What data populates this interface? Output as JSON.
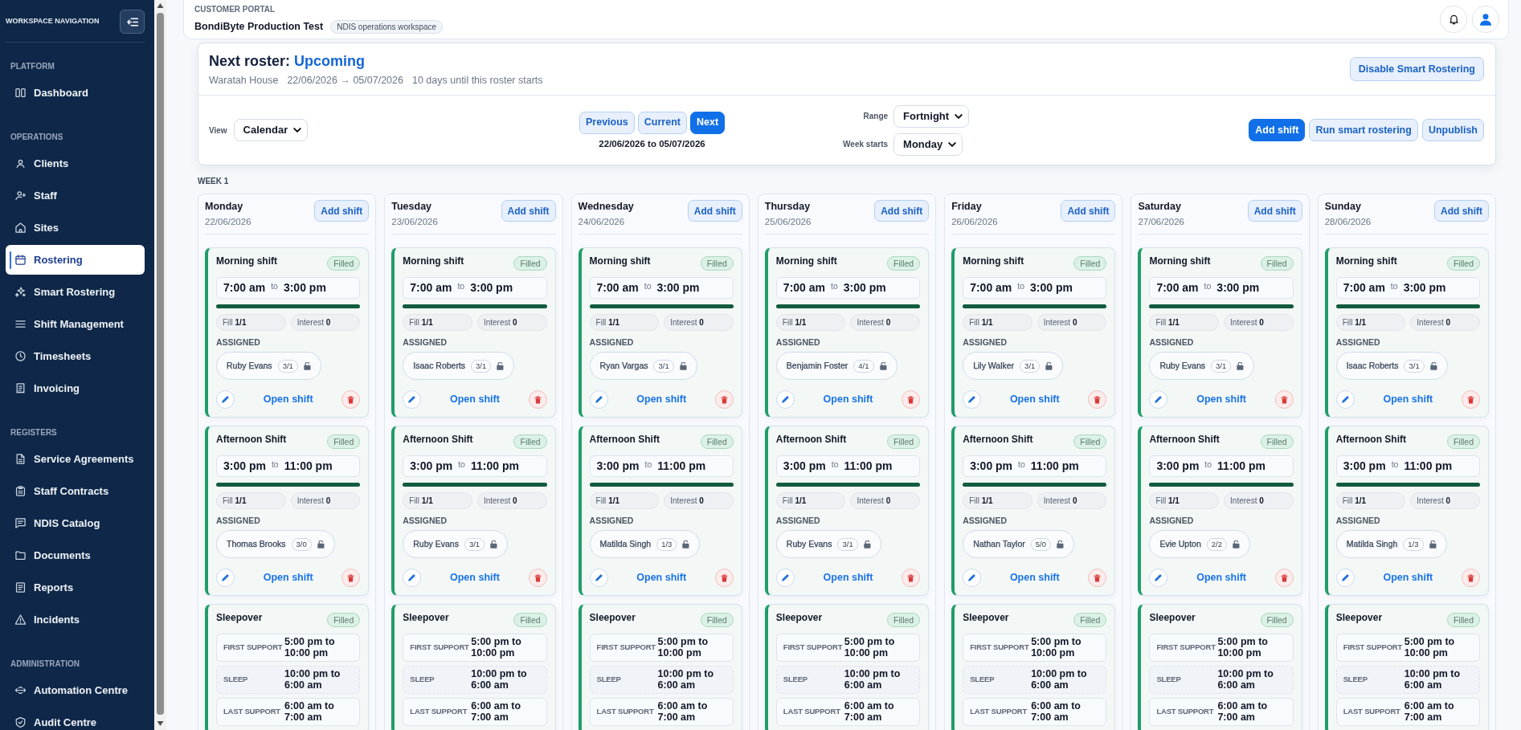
{
  "sidebar": {
    "title": "WORKSPACE NAVIGATION",
    "sections": [
      {
        "heading": "PLATFORM",
        "items": [
          {
            "label": "Dashboard",
            "selected": false
          }
        ]
      },
      {
        "heading": "OPERATIONS",
        "items": [
          {
            "label": "Clients",
            "selected": false
          },
          {
            "label": "Staff",
            "selected": false
          },
          {
            "label": "Sites",
            "selected": false
          },
          {
            "label": "Rostering",
            "selected": true
          },
          {
            "label": "Smart Rostering",
            "selected": false
          },
          {
            "label": "Shift Management",
            "selected": false
          },
          {
            "label": "Timesheets",
            "selected": false
          },
          {
            "label": "Invoicing",
            "selected": false
          }
        ]
      },
      {
        "heading": "REGISTERS",
        "items": [
          {
            "label": "Service Agreements",
            "selected": false
          },
          {
            "label": "Staff Contracts",
            "selected": false
          },
          {
            "label": "NDIS Catalog",
            "selected": false
          },
          {
            "label": "Documents",
            "selected": false
          },
          {
            "label": "Reports",
            "selected": false
          },
          {
            "label": "Incidents",
            "selected": false
          }
        ]
      },
      {
        "heading": "ADMINISTRATION",
        "items": [
          {
            "label": "Automation Centre",
            "selected": false
          },
          {
            "label": "Audit Centre",
            "selected": false
          }
        ]
      }
    ]
  },
  "header": {
    "eyebrow": "CUSTOMER PORTAL",
    "title": "BondiByte Production Test",
    "badge": "NDIS operations workspace"
  },
  "roster": {
    "title": "Next roster:",
    "status": "Upcoming",
    "details": [
      "Waratah House",
      "22/06/2026 → 05/07/2026",
      "10 days until this roster starts"
    ],
    "action": "Disable Smart Rostering"
  },
  "toolbar": {
    "view": {
      "label": "View",
      "value": "Calendar"
    },
    "nav": [
      {
        "label": "Previous",
        "selected": false
      },
      {
        "label": "Current",
        "selected": false
      },
      {
        "label": "Next",
        "selected": true
      }
    ],
    "period": "22/06/2026 to 05/07/2026",
    "range": {
      "label": "Range",
      "value": "Fortnight"
    },
    "week_start": {
      "label": "Week starts",
      "value": "Monday"
    },
    "actions": [
      {
        "label": "Add shift",
        "primary": true
      },
      {
        "label": "Run smart rostering",
        "primary": false
      },
      {
        "label": "Unpublish",
        "primary": false
      }
    ]
  },
  "week": {
    "label": "WEEK 1",
    "days": [
      {
        "name": "Monday",
        "date": "22/06/2026",
        "add_label": "Add shift",
        "shifts": [
          {
            "kind": "standard",
            "title": "Morning shift",
            "status": "Filled",
            "start": "7:00 am",
            "to": "to",
            "end": "3:00 pm",
            "level": 1,
            "fill": "Fill **1/1**",
            "interest": "Interest **0**",
            "assigned_label": "ASSIGNED",
            "assignees": [
              {
                "name": "Ruby Evans",
                "count": "3/1",
                "locked": false
              }
            ],
            "open_label": "Open shift"
          },
          {
            "kind": "standard",
            "title": "Afternoon Shift",
            "status": "Filled",
            "start": "3:00 pm",
            "to": "to",
            "end": "11:00 pm",
            "level": 1,
            "fill": "Fill **1/1**",
            "interest": "Interest **0**",
            "assigned_label": "ASSIGNED",
            "assignees": [
              {
                "name": "Thomas Brooks",
                "count": "3/0",
                "locked": false
              }
            ],
            "open_label": "Open shift"
          },
          {
            "kind": "sleepover",
            "title": "Sleepover",
            "status": "Filled",
            "segments": [
              {
                "kind": "support",
                "label": "FIRST SUPPORT",
                "time": "5:00 pm to 10:00 pm"
              },
              {
                "kind": "sleep",
                "label": "SLEEP",
                "time": "10:00 pm to 6:00 am"
              },
              {
                "kind": "support",
                "label": "LAST SUPPORT",
                "time": "6:00 am to 7:00 am"
              }
            ]
          }
        ]
      },
      {
        "name": "Tuesday",
        "date": "23/06/2026",
        "add_label": "Add shift",
        "shifts": [
          {
            "kind": "standard",
            "title": "Morning shift",
            "status": "Filled",
            "start": "7:00 am",
            "to": "to",
            "end": "3:00 pm",
            "level": 1,
            "fill": "Fill **1/1**",
            "interest": "Interest **0**",
            "assigned_label": "ASSIGNED",
            "assignees": [
              {
                "name": "Isaac Roberts",
                "count": "3/1",
                "locked": false
              }
            ],
            "open_label": "Open shift"
          },
          {
            "kind": "standard",
            "title": "Afternoon Shift",
            "status": "Filled",
            "start": "3:00 pm",
            "to": "to",
            "end": "11:00 pm",
            "level": 1,
            "fill": "Fill **1/1**",
            "interest": "Interest **0**",
            "assigned_label": "ASSIGNED",
            "assignees": [
              {
                "name": "Ruby Evans",
                "count": "3/1",
                "locked": false
              }
            ],
            "open_label": "Open shift"
          },
          {
            "kind": "sleepover",
            "title": "Sleepover",
            "status": "Filled",
            "segments": [
              {
                "kind": "support",
                "label": "FIRST SUPPORT",
                "time": "5:00 pm to 10:00 pm"
              },
              {
                "kind": "sleep",
                "label": "SLEEP",
                "time": "10:00 pm to 6:00 am"
              },
              {
                "kind": "support",
                "label": "LAST SUPPORT",
                "time": "6:00 am to 7:00 am"
              }
            ]
          }
        ]
      },
      {
        "name": "Wednesday",
        "date": "24/06/2026",
        "add_label": "Add shift",
        "shifts": [
          {
            "kind": "standard",
            "title": "Morning shift",
            "status": "Filled",
            "start": "7:00 am",
            "to": "to",
            "end": "3:00 pm",
            "level": 1,
            "fill": "Fill **1/1**",
            "interest": "Interest **0**",
            "assigned_label": "ASSIGNED",
            "assignees": [
              {
                "name": "Ryan Vargas",
                "count": "3/1",
                "locked": false
              }
            ],
            "open_label": "Open shift"
          },
          {
            "kind": "standard",
            "title": "Afternoon Shift",
            "status": "Filled",
            "start": "3:00 pm",
            "to": "to",
            "end": "11:00 pm",
            "level": 1,
            "fill": "Fill **1/1**",
            "interest": "Interest **0**",
            "assigned_label": "ASSIGNED",
            "assignees": [
              {
                "name": "Matilda Singh",
                "count": "1/3",
                "locked": false
              }
            ],
            "open_label": "Open shift"
          },
          {
            "kind": "sleepover",
            "title": "Sleepover",
            "status": "Filled",
            "segments": [
              {
                "kind": "support",
                "label": "FIRST SUPPORT",
                "time": "5:00 pm to 10:00 pm"
              },
              {
                "kind": "sleep",
                "label": "SLEEP",
                "time": "10:00 pm to 6:00 am"
              },
              {
                "kind": "support",
                "label": "LAST SUPPORT",
                "time": "6:00 am to 7:00 am"
              }
            ]
          }
        ]
      },
      {
        "name": "Thursday",
        "date": "25/06/2026",
        "add_label": "Add shift",
        "shifts": [
          {
            "kind": "standard",
            "title": "Morning shift",
            "status": "Filled",
            "start": "7:00 am",
            "to": "to",
            "end": "3:00 pm",
            "level": 1,
            "fill": "Fill **1/1**",
            "interest": "Interest **0**",
            "assigned_label": "ASSIGNED",
            "assignees": [
              {
                "name": "Benjamin Foster",
                "count": "4/1",
                "locked": false
              }
            ],
            "open_label": "Open shift"
          },
          {
            "kind": "standard",
            "title": "Afternoon Shift",
            "status": "Filled",
            "start": "3:00 pm",
            "to": "to",
            "end": "11:00 pm",
            "level": 1,
            "fill": "Fill **1/1**",
            "interest": "Interest **0**",
            "assigned_label": "ASSIGNED",
            "assignees": [
              {
                "name": "Ruby Evans",
                "count": "3/1",
                "locked": false
              }
            ],
            "open_label": "Open shift"
          },
          {
            "kind": "sleepover",
            "title": "Sleepover",
            "status": "Filled",
            "segments": [
              {
                "kind": "support",
                "label": "FIRST SUPPORT",
                "time": "5:00 pm to 10:00 pm"
              },
              {
                "kind": "sleep",
                "label": "SLEEP",
                "time": "10:00 pm to 6:00 am"
              },
              {
                "kind": "support",
                "label": "LAST SUPPORT",
                "time": "6:00 am to 7:00 am"
              }
            ]
          }
        ]
      },
      {
        "name": "Friday",
        "date": "26/06/2026",
        "add_label": "Add shift",
        "shifts": [
          {
            "kind": "standard",
            "title": "Morning shift",
            "status": "Filled",
            "start": "7:00 am",
            "to": "to",
            "end": "3:00 pm",
            "level": 1,
            "fill": "Fill **1/1**",
            "interest": "Interest **0**",
            "assigned_label": "ASSIGNED",
            "assignees": [
              {
                "name": "Lily Walker",
                "count": "3/1",
                "locked": false
              }
            ],
            "open_label": "Open shift"
          },
          {
            "kind": "standard",
            "title": "Afternoon Shift",
            "status": "Filled",
            "start": "3:00 pm",
            "to": "to",
            "end": "11:00 pm",
            "level": 1,
            "fill": "Fill **1/1**",
            "interest": "Interest **0**",
            "assigned_label": "ASSIGNED",
            "assignees": [
              {
                "name": "Nathan Taylor",
                "count": "5/0",
                "locked": false
              }
            ],
            "open_label": "Open shift"
          },
          {
            "kind": "sleepover",
            "title": "Sleepover",
            "status": "Filled",
            "segments": [
              {
                "kind": "support",
                "label": "FIRST SUPPORT",
                "time": "5:00 pm to 10:00 pm"
              },
              {
                "kind": "sleep",
                "label": "SLEEP",
                "time": "10:00 pm to 6:00 am"
              },
              {
                "kind": "support",
                "label": "LAST SUPPORT",
                "time": "6:00 am to 7:00 am"
              }
            ]
          }
        ]
      },
      {
        "name": "Saturday",
        "date": "27/06/2026",
        "add_label": "Add shift",
        "shifts": [
          {
            "kind": "standard",
            "title": "Morning shift",
            "status": "Filled",
            "start": "7:00 am",
            "to": "to",
            "end": "3:00 pm",
            "level": 1,
            "fill": "Fill **1/1**",
            "interest": "Interest **0**",
            "assigned_label": "ASSIGNED",
            "assignees": [
              {
                "name": "Ruby Evans",
                "count": "3/1",
                "locked": false
              }
            ],
            "open_label": "Open shift"
          },
          {
            "kind": "standard",
            "title": "Afternoon Shift",
            "status": "Filled",
            "start": "3:00 pm",
            "to": "to",
            "end": "11:00 pm",
            "level": 1,
            "fill": "Fill **1/1**",
            "interest": "Interest **0**",
            "assigned_label": "ASSIGNED",
            "assignees": [
              {
                "name": "Evie Upton",
                "count": "2/2",
                "locked": false
              }
            ],
            "open_label": "Open shift"
          },
          {
            "kind": "sleepover",
            "title": "Sleepover",
            "status": "Filled",
            "segments": [
              {
                "kind": "support",
                "label": "FIRST SUPPORT",
                "time": "5:00 pm to 10:00 pm"
              },
              {
                "kind": "sleep",
                "label": "SLEEP",
                "time": "10:00 pm to 6:00 am"
              },
              {
                "kind": "support",
                "label": "LAST SUPPORT",
                "time": "6:00 am to 7:00 am"
              }
            ]
          }
        ]
      },
      {
        "name": "Sunday",
        "date": "28/06/2026",
        "add_label": "Add shift",
        "shifts": [
          {
            "kind": "standard",
            "title": "Morning shift",
            "status": "Filled",
            "start": "7:00 am",
            "to": "to",
            "end": "3:00 pm",
            "level": 1,
            "fill": "Fill **1/1**",
            "interest": "Interest **0**",
            "assigned_label": "ASSIGNED",
            "assignees": [
              {
                "name": "Isaac Roberts",
                "count": "3/1",
                "locked": false
              }
            ],
            "open_label": "Open shift"
          },
          {
            "kind": "standard",
            "title": "Afternoon Shift",
            "status": "Filled",
            "start": "3:00 pm",
            "to": "to",
            "end": "11:00 pm",
            "level": 1,
            "fill": "Fill **1/1**",
            "interest": "Interest **0**",
            "assigned_label": "ASSIGNED",
            "assignees": [
              {
                "name": "Matilda Singh",
                "count": "1/3",
                "locked": false
              }
            ],
            "open_label": "Open shift"
          },
          {
            "kind": "sleepover",
            "title": "Sleepover",
            "status": "Filled",
            "segments": [
              {
                "kind": "support",
                "label": "FIRST SUPPORT",
                "time": "5:00 pm to 10:00 pm"
              },
              {
                "kind": "sleep",
                "label": "SLEEP",
                "time": "10:00 pm to 6:00 am"
              },
              {
                "kind": "support",
                "label": "LAST SUPPORT",
                "time": "6:00 am to 7:00 am"
              }
            ]
          }
        ]
      }
    ]
  }
}
